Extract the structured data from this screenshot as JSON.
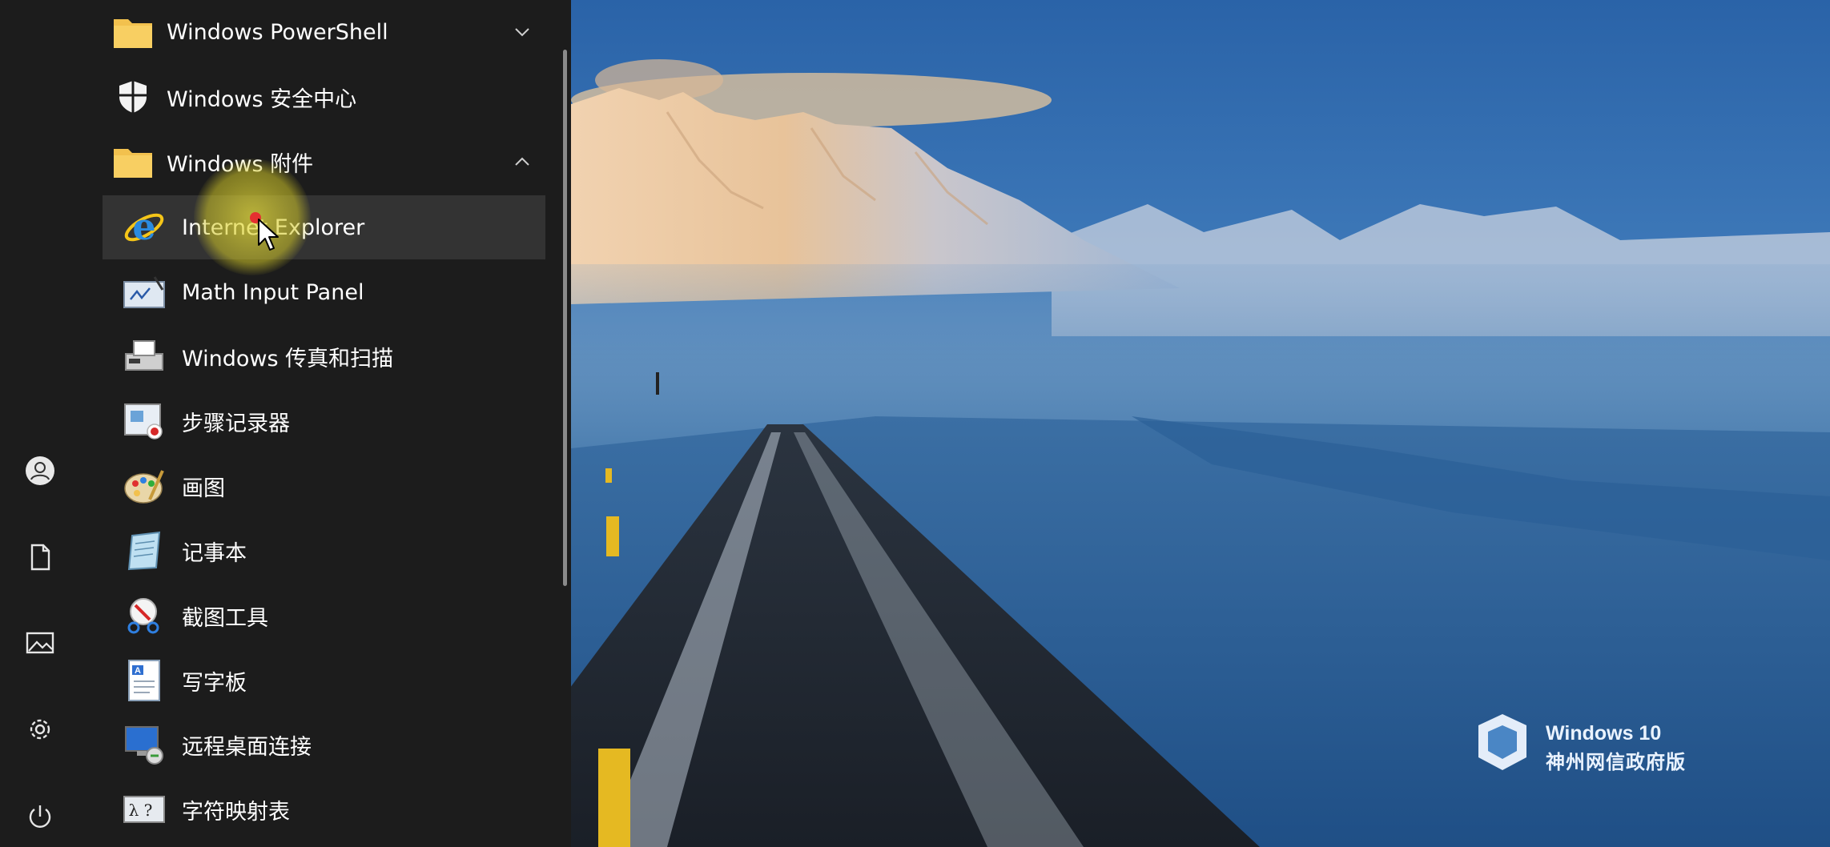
{
  "start_menu": {
    "apps": [
      {
        "label": "Windows PowerShell",
        "icon": "folder-icon",
        "kind": "folder",
        "expanded": false
      },
      {
        "label": "Windows 安全中心",
        "icon": "shield-icon",
        "kind": "app"
      },
      {
        "label": "Windows 附件",
        "icon": "folder-icon",
        "kind": "folder",
        "expanded": true
      },
      {
        "label": "Internet Explorer",
        "icon": "internet-explorer-icon",
        "kind": "sub",
        "hovered": true
      },
      {
        "label": "Math Input Panel",
        "icon": "math-input-panel-icon",
        "kind": "sub"
      },
      {
        "label": "Windows 传真和扫描",
        "icon": "fax-scan-icon",
        "kind": "sub"
      },
      {
        "label": "步骤记录器",
        "icon": "steps-recorder-icon",
        "kind": "sub"
      },
      {
        "label": "画图",
        "icon": "paint-icon",
        "kind": "sub"
      },
      {
        "label": "记事本",
        "icon": "notepad-icon",
        "kind": "sub"
      },
      {
        "label": "截图工具",
        "icon": "snipping-tool-icon",
        "kind": "sub"
      },
      {
        "label": "写字板",
        "icon": "wordpad-icon",
        "kind": "sub"
      },
      {
        "label": "远程桌面连接",
        "icon": "remote-desktop-icon",
        "kind": "sub"
      },
      {
        "label": "字符映射表",
        "icon": "character-map-icon",
        "kind": "sub"
      }
    ],
    "rail": [
      "user-icon",
      "document-icon",
      "pictures-icon",
      "settings-icon",
      "power-icon"
    ]
  },
  "desktop": {
    "watermark_title": "Windows 10",
    "watermark_subtitle": "神州网信政府版"
  },
  "colors": {
    "panel_bg": "#1c1c1c",
    "hover_bg": "#333333",
    "folder": "#f2c14e",
    "sky": "#2a63a8"
  }
}
